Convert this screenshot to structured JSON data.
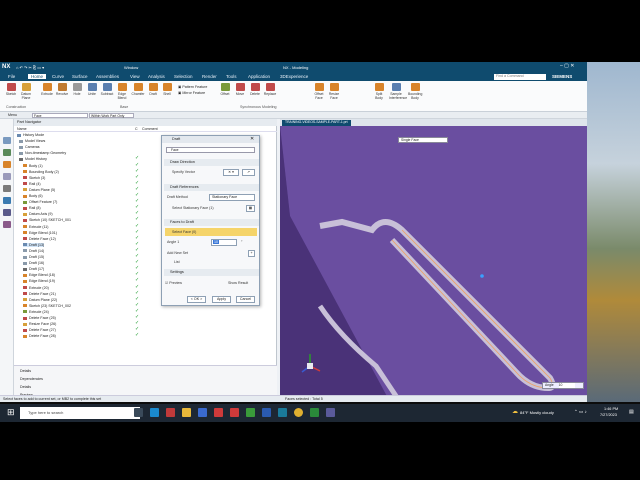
{
  "app": {
    "logo": "NX",
    "title": "NX - Modeling",
    "brand": "SIEMENS",
    "window_menu": "Window"
  },
  "menu": [
    "File",
    "Home",
    "Curve",
    "Surface",
    "Assemblies",
    "View",
    "Analysis",
    "Selection",
    "Render",
    "Tools",
    "Application",
    "3DExperience"
  ],
  "search_placeholder": "Find a Command",
  "ribbon": {
    "buttons": [
      "Sketch",
      "Datum Plane",
      "Extrude",
      "Revolve",
      "Hole",
      "Unite",
      "Subtract",
      "Edge Blend",
      "Chamfer",
      "Draft",
      "Shell",
      "Offset",
      "Move",
      "Delete",
      "Replace",
      "Offset Face",
      "Resize Face",
      "Split Body",
      "Sample Interference",
      "Bounding Body"
    ],
    "groups": [
      "Construction",
      "Base",
      "Synchronous Modeling"
    ]
  },
  "cmdbar": {
    "menu": "Menu",
    "filter": "Face",
    "scope": "Within Work Part Only"
  },
  "nav": {
    "title": "Part Navigator",
    "columns": [
      "Name",
      "C",
      "Comment"
    ],
    "rows": [
      "History Mode",
      "Model Views",
      "Cameras",
      "Non-timestamp Geometry",
      "Model History",
      "Body (1)",
      "Bounding Body (2)",
      "Sketch (3)",
      "Rail (4)",
      "Datum Plane (5)",
      "Body (6)",
      "Offset Feature (7)",
      "Rail (8)",
      "Datum Axis (9)",
      "Sketch (10) SKETCH_001",
      "Extrude (11)",
      "Edge Blend (101)",
      "Delete Face (12)",
      "Draft (13)",
      "Draft (14)",
      "Draft (15)",
      "Draft (16)",
      "Draft (17)",
      "Edge Blend (18)",
      "Edge Blend (19)",
      "Extrude (20)",
      "Delete Face (21)",
      "Datum Plane (22)",
      "Sketch (23) SKETCH_002",
      "Extrude (24)",
      "Delete Face (25)",
      "Resize Face (26)",
      "Delete Face (27)",
      "Delete Face (28)"
    ],
    "bottom": [
      "Details",
      "Dependencies",
      "Details",
      "Preview"
    ]
  },
  "dialog": {
    "title": "Draft",
    "type": "Face",
    "sections": [
      "Draw Direction",
      "Draft References",
      "Faces to Draft",
      "Settings"
    ],
    "specify_vector": "Specify Vector",
    "draft_method_label": "Draft Method",
    "draft_method": "Stationary Face",
    "stationary": "Select Stationary Face (1)",
    "select_face": "Select Face (0)",
    "angle_label": "Angle 1",
    "angle_value": "10",
    "angle_unit": "°",
    "add_new": "Add New Set",
    "list": "List",
    "preview": "Preview",
    "show_result": "Show Result",
    "ok": "< OK >",
    "apply": "Apply",
    "cancel": "Cancel"
  },
  "viewport": {
    "tab": "TRAINING-VIDEOS-SAMPLE-PART-1.prt",
    "select_face": "Single Face",
    "angle_label": "Angle",
    "angle_value": "10"
  },
  "status": {
    "left": "Select faces to add to current set, or MB2 to complete this set",
    "right": "Faces selected : Total 5"
  },
  "taskbar": {
    "search": "Type here to search",
    "weather": "84°F  Mostly cloudy",
    "time": "1:46 PM",
    "date": "7/27/2023"
  }
}
